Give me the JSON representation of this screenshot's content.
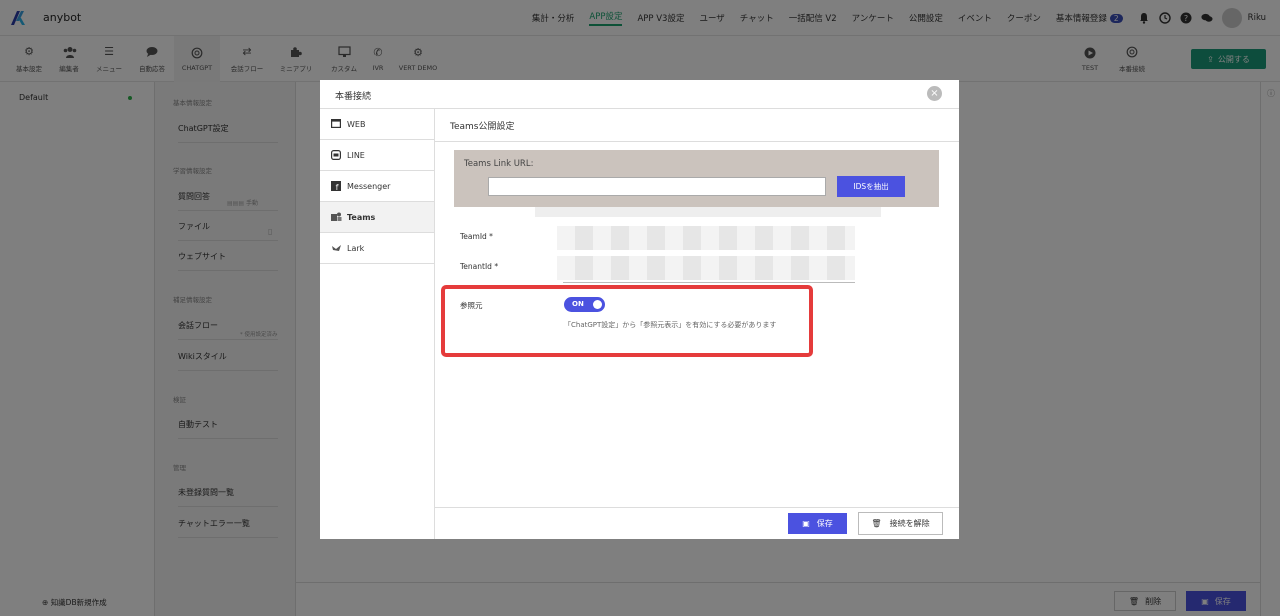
{
  "app": {
    "brand": "anybot",
    "user": "Riku"
  },
  "topnav": [
    {
      "label": "集計・分析"
    },
    {
      "label": "APP設定",
      "active": true
    },
    {
      "label": "APP V3設定"
    },
    {
      "label": "ユーザ"
    },
    {
      "label": "チャット"
    },
    {
      "label": "一括配信 V2"
    },
    {
      "label": "アンケート"
    },
    {
      "label": "公開設定"
    },
    {
      "label": "イベント"
    },
    {
      "label": "クーポン"
    },
    {
      "label": "基本情報登録",
      "badge": "2"
    }
  ],
  "toolbar": {
    "items": [
      {
        "label": "基本設定",
        "icon": "gear-icon"
      },
      {
        "label": "編集者",
        "icon": "users-icon"
      },
      {
        "label": "メニュー",
        "icon": "menu-icon"
      },
      {
        "label": "自動応答",
        "icon": "chat-icon"
      },
      {
        "label": "CHATGPT",
        "icon": "openai-icon",
        "active": true
      },
      {
        "label": "会話フロー",
        "icon": "shuffle-icon"
      },
      {
        "label": "ミニアプリ",
        "icon": "puzzle-icon"
      },
      {
        "label": "カスタム",
        "icon": "monitor-icon"
      },
      {
        "label": "IVR",
        "icon": "phone-icon"
      },
      {
        "label": "VERT DEMO",
        "icon": "gear-icon"
      }
    ],
    "right_items": [
      {
        "label": "TEST",
        "icon": "play-icon"
      },
      {
        "label": "本番接続",
        "icon": "openai-icon"
      }
    ],
    "publish_label": "公開する"
  },
  "left_panel": {
    "default_label": "Default",
    "new_db_label": "知識DB新規作成"
  },
  "sidebar": {
    "sections": [
      {
        "title": "基本情報設定",
        "items": [
          "ChatGPT設定"
        ]
      },
      {
        "title": "学習情報設定",
        "items": [
          "質問回答",
          "ファイル",
          "ウェブサイト"
        ]
      },
      {
        "title": "補足情報設定",
        "items": [
          "会話フロー",
          "Wikiスタイル"
        ]
      },
      {
        "title": "検証",
        "items": [
          "自動テスト"
        ]
      },
      {
        "title": "管理",
        "items": [
          "未登録質問一覧",
          "チャットエラー一覧"
        ]
      }
    ],
    "hint_qa": "手動",
    "hint_flow": "* 使用設定済み"
  },
  "bottom": {
    "delete_label": "削除",
    "save_label": "保存"
  },
  "modal": {
    "title": "本番接続",
    "tabs": [
      {
        "label": "WEB",
        "icon": "web-icon"
      },
      {
        "label": "LINE",
        "icon": "line-icon"
      },
      {
        "label": "Messenger",
        "icon": "facebook-icon"
      },
      {
        "label": "Teams",
        "icon": "teams-icon",
        "active": true
      },
      {
        "label": "Lark",
        "icon": "lark-icon"
      }
    ],
    "content_title": "Teams公開設定",
    "link_label": "Teams Link URL:",
    "link_value": "",
    "extract_label": "IDSを抽出",
    "team_id_label": "TeamId *",
    "tenant_id_label": "TenantId *",
    "ref_label": "参照元",
    "toggle_label": "ON",
    "toggle_on": true,
    "ref_note": "「ChatGPT設定」から「参照元表示」を有効にする必要があります",
    "save_label": "保存",
    "disconnect_label": "接続を解除"
  },
  "colors": {
    "accent": "#4b52e0",
    "highlight": "#e53b3b",
    "publish": "#1a9a7a",
    "nav_active": "#1aa36f"
  }
}
